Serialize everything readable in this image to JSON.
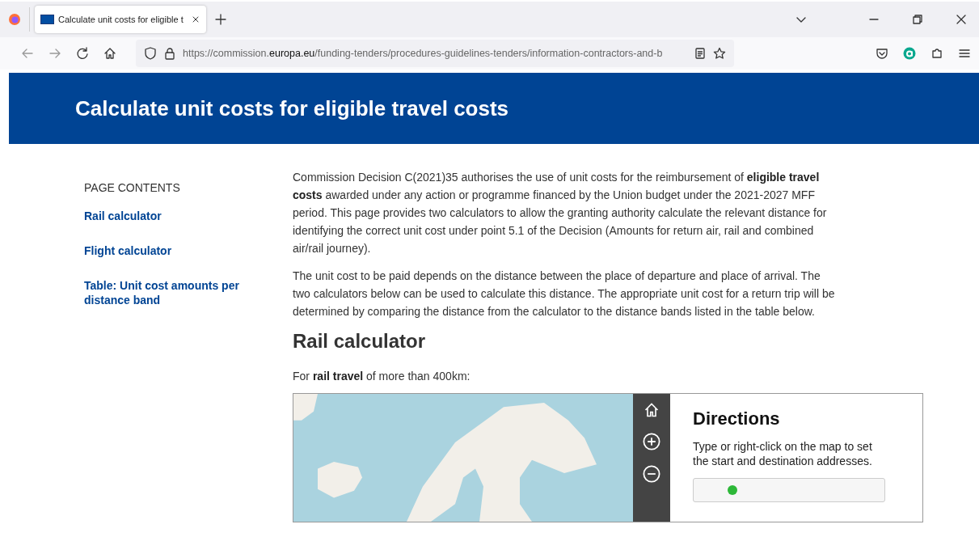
{
  "browser": {
    "tab": {
      "title": "Calculate unit costs for eligible t",
      "selected": true
    },
    "url": {
      "prefix": "https://commission.",
      "domain": "europa.eu",
      "path": "/funding-tenders/procedures-guidelines-tenders/information-contractors-and-b"
    }
  },
  "banner": {
    "title": "Calculate unit costs for eligible travel costs"
  },
  "sidebar": {
    "heading": "PAGE CONTENTS",
    "items": [
      {
        "label": "Rail calculator"
      },
      {
        "label": "Flight calculator"
      },
      {
        "label": "Table: Unit cost amounts per distance band"
      }
    ]
  },
  "content": {
    "paragraphs": [
      "Commission Decision C(2021)35 authorises the use of unit costs for the reimbursement of **eligible travel costs** awarded under any action or programme financed by the Union budget under the 2021-2027 MFF period. This page provides two calculators to allow the granting authority calculate the relevant distance for identifying the correct unit cost under point 5.1 of the Decision (Amounts for return air, rail and combined air/rail journey).",
      "The unit cost to be paid depends on the distance between the place of departure and place of arrival. The two calculators below can be used to calculate this distance. The appropriate unit cost for a return trip will be determined by comparing the distance from the calculator to the distance bands listed in the table below."
    ],
    "section_heading": "Rail calculator",
    "intro": "For **rail travel** of more than 400km:",
    "directions": {
      "title": "Directions",
      "hint": "Type or right-click on the map to set the start and destination addresses."
    }
  }
}
